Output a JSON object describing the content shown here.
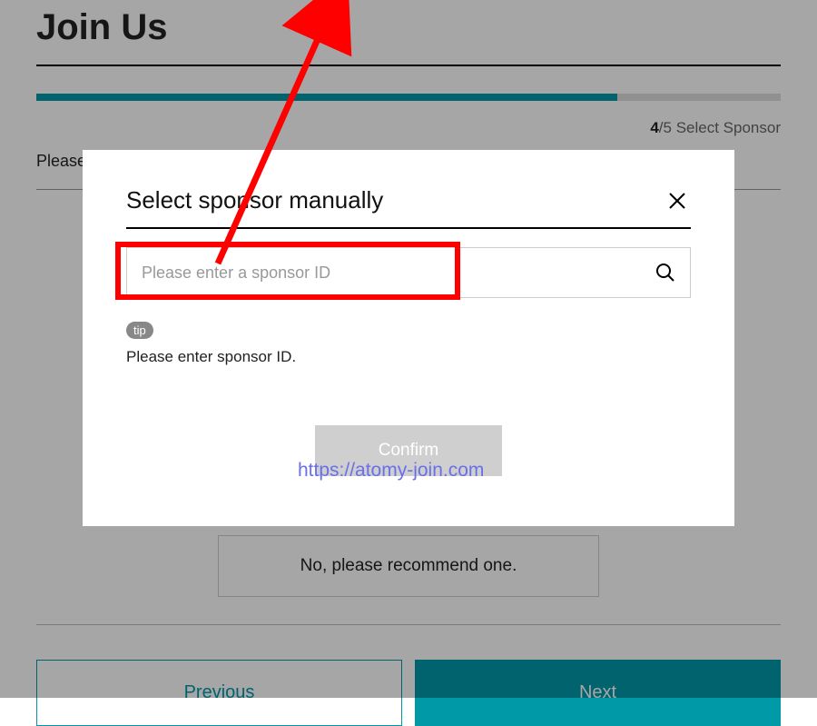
{
  "page": {
    "title": "Join Us",
    "prompt": "Please",
    "step": {
      "current": "4",
      "total": "/5",
      "label": " Select Sponsor"
    },
    "option_recommend": "No, please recommend one.",
    "nav": {
      "previous": "Previous",
      "next": "Next"
    }
  },
  "modal": {
    "title": "Select sponsor manually",
    "input_placeholder": "Please enter a sponsor ID",
    "tip_badge": "tip",
    "tip_text": "Please enter sponsor ID.",
    "confirm": "Confirm"
  },
  "watermark": "https://atomy-join.com",
  "colors": {
    "accent": "#0099a8",
    "highlight": "#ff0000",
    "watermark": "#6b6fe8"
  }
}
